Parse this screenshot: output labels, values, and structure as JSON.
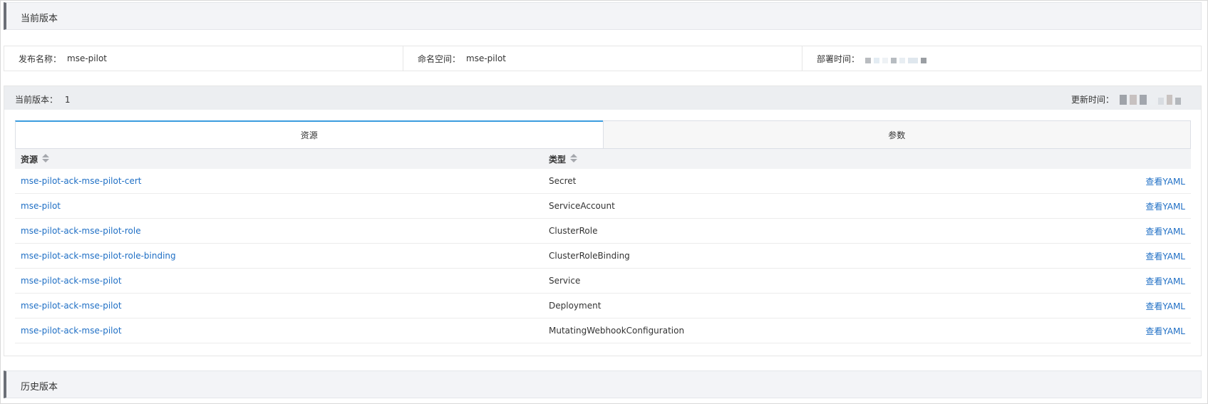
{
  "current_section": {
    "title": "当前版本"
  },
  "info": {
    "release_label": "发布名称：",
    "release_value": "mse-pilot",
    "namespace_label": "命名空间：",
    "namespace_value": "mse-pilot",
    "deploy_time_label": "部署时间："
  },
  "version": {
    "label": "当前版本：",
    "value": "1",
    "updated_label": "更新时间："
  },
  "tabs": [
    {
      "label": "资源",
      "active": true
    },
    {
      "label": "参数",
      "active": false
    }
  ],
  "table": {
    "headers": {
      "resource": "资源",
      "type": "类型"
    },
    "action_label": "查看YAML",
    "rows": [
      {
        "resource": "mse-pilot-ack-mse-pilot-cert",
        "type": "Secret"
      },
      {
        "resource": "mse-pilot",
        "type": "ServiceAccount"
      },
      {
        "resource": "mse-pilot-ack-mse-pilot-role",
        "type": "ClusterRole"
      },
      {
        "resource": "mse-pilot-ack-mse-pilot-role-binding",
        "type": "ClusterRoleBinding"
      },
      {
        "resource": "mse-pilot-ack-mse-pilot",
        "type": "Service"
      },
      {
        "resource": "mse-pilot-ack-mse-pilot",
        "type": "Deployment"
      },
      {
        "resource": "mse-pilot-ack-mse-pilot",
        "type": "MutatingWebhookConfiguration"
      }
    ]
  },
  "history_section": {
    "title": "历史版本"
  },
  "colors": {
    "link": "#1f6fc5",
    "tab_active_border": "#3b9cde",
    "section_accent": "#6b6f77"
  }
}
